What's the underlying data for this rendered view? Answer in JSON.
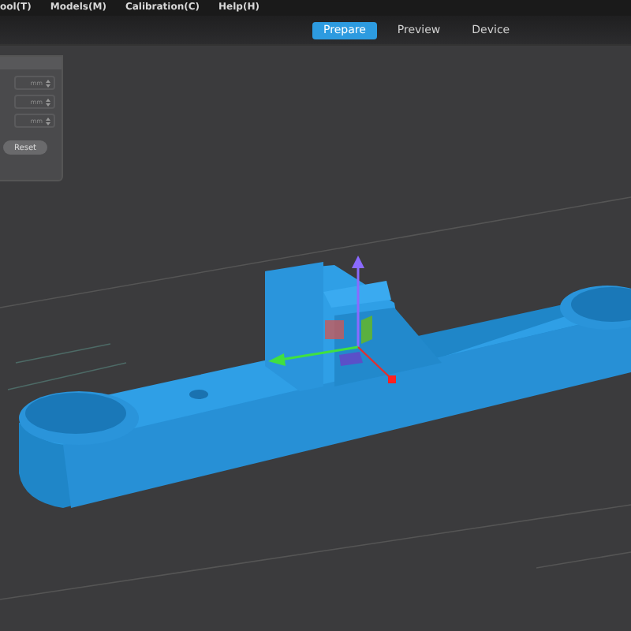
{
  "menu": [
    {
      "label": "ool(T)"
    },
    {
      "label": "Models(M)"
    },
    {
      "label": "Calibration(C)"
    },
    {
      "label": "Help(H)"
    }
  ],
  "tabs": [
    {
      "label": "Prepare",
      "selected": true
    },
    {
      "label": "Preview",
      "selected": false
    },
    {
      "label": "Device",
      "selected": false
    }
  ],
  "panel": {
    "fields": [
      {
        "unit": "mm"
      },
      {
        "unit": "mm"
      },
      {
        "unit": "mm"
      }
    ],
    "reset_button": "Reset"
  }
}
